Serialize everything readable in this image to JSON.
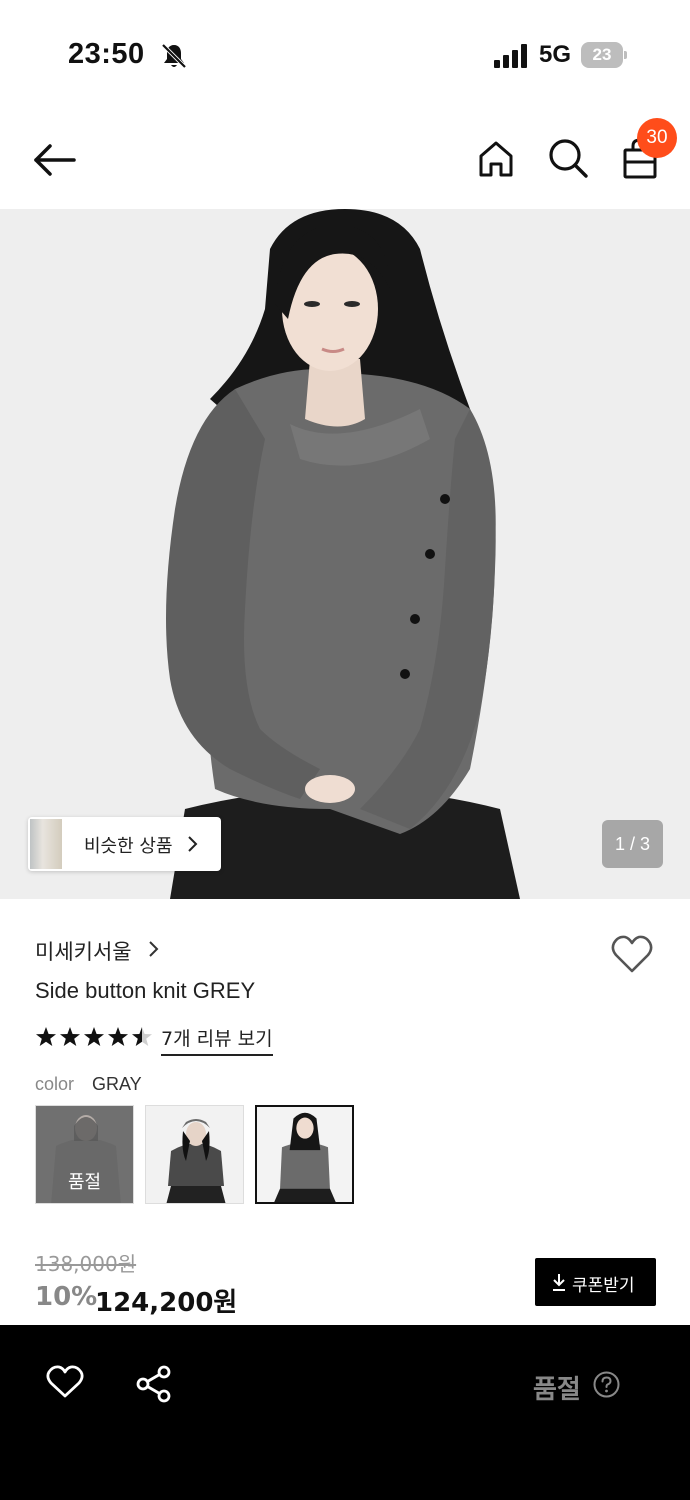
{
  "status_bar": {
    "time": "23:50",
    "network": "5G",
    "battery": "23"
  },
  "nav": {
    "cart_count": "30"
  },
  "hero": {
    "similar_label": "비슷한 상품",
    "page_indicator": "1 / 3"
  },
  "product": {
    "brand": "미세키서울",
    "name": "Side button knit GREY",
    "rating": 4.5,
    "review_link": "7개 리뷰 보기",
    "option_label": "color",
    "option_value": "GRAY",
    "swatch_soldout_label": "품절",
    "original_price": "138,000원",
    "discount": "10%",
    "sale_price": "124,200원",
    "coupon_label": "쿠폰받기"
  },
  "bottom_bar": {
    "status_label": "품절"
  },
  "colors": {
    "badge": "#ff4d1a",
    "bottom_bar": "#000000",
    "sweater": "#6b6b6b"
  }
}
